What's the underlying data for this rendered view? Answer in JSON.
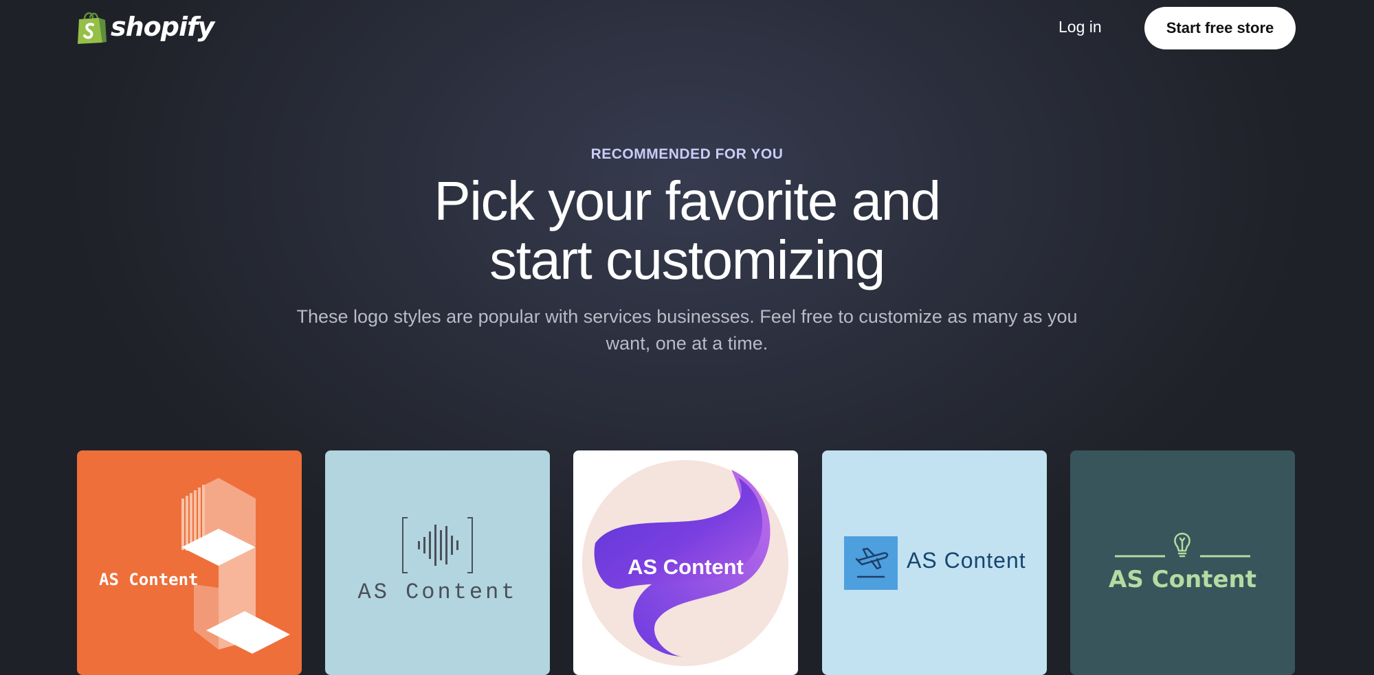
{
  "brand": {
    "name": "shopify",
    "bag_color": "#95bf47"
  },
  "nav": {
    "login_label": "Log in",
    "start_label": "Start free store"
  },
  "hero": {
    "eyebrow": "RECOMMENDED FOR YOU",
    "headline_line1": "Pick your favorite and",
    "headline_line2": "start customizing",
    "subtext": "These logo styles are popular with services businesses. Feel free to customize as many as you want, one at a time."
  },
  "logo_cards": [
    {
      "label": "AS Content",
      "background": "#ee6f3a",
      "icon": "isometric-stairs-icon"
    },
    {
      "label": "AS Content",
      "background": "#b2d5df",
      "icon": "audio-waveform-icon"
    },
    {
      "label": "AS Content",
      "background": "#ffffff",
      "icon": "purple-ribbon-icon"
    },
    {
      "label": "AS Content",
      "background": "#c2e2f2",
      "icon": "airplane-icon"
    },
    {
      "label": "AS Content",
      "background": "#38555b",
      "icon": "lightbulb-icon"
    }
  ]
}
